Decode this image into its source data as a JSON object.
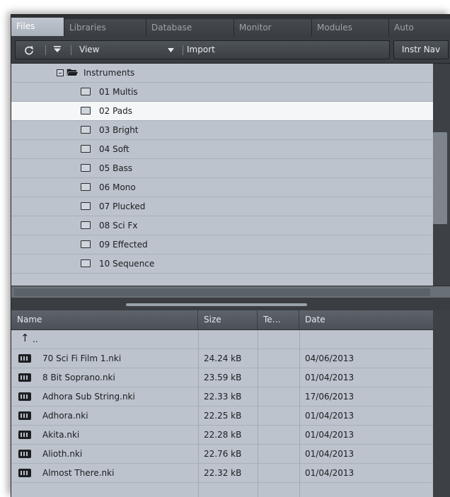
{
  "tabs": [
    {
      "label": "Files",
      "active": true
    },
    {
      "label": "Libraries",
      "active": false
    },
    {
      "label": "Database",
      "active": false
    },
    {
      "label": "Monitor",
      "active": false
    },
    {
      "label": "Modules",
      "active": false
    },
    {
      "label": "Auto",
      "active": false
    }
  ],
  "toolbar": {
    "refresh_icon": "refresh-icon",
    "menu_icon": "triangle-down-icon",
    "view_label": "View",
    "view_dropdown_icon": "triangle-down-icon",
    "import_label": "Import",
    "instr_nav_label": "Instr Nav"
  },
  "tree": {
    "parent": {
      "label": "Instruments",
      "expanded": true
    },
    "folders": [
      {
        "label": "01 Multis",
        "selected": false
      },
      {
        "label": "02 Pads",
        "selected": true
      },
      {
        "label": "03 Bright",
        "selected": false
      },
      {
        "label": "04 Soft",
        "selected": false
      },
      {
        "label": "05 Bass",
        "selected": false
      },
      {
        "label": "06 Mono",
        "selected": false
      },
      {
        "label": "07 Plucked",
        "selected": false
      },
      {
        "label": "08 Sci Fx",
        "selected": false
      },
      {
        "label": "09 Effected",
        "selected": false
      },
      {
        "label": "10 Sequence",
        "selected": false
      }
    ]
  },
  "table": {
    "columns": [
      "Name",
      "Size",
      "Te…",
      "Date"
    ],
    "parent_row": {
      "label": ".."
    },
    "rows": [
      {
        "name": "70 Sci Fi Film 1.nki",
        "size": "24.24 kB",
        "te": "",
        "date": "04/06/2013"
      },
      {
        "name": "8 Bit Soprano.nki",
        "size": "23.59 kB",
        "te": "",
        "date": "01/04/2013"
      },
      {
        "name": "Adhora Sub String.nki",
        "size": "22.33 kB",
        "te": "",
        "date": "17/06/2013"
      },
      {
        "name": "Adhora.nki",
        "size": "22.25 kB",
        "te": "",
        "date": "01/04/2013"
      },
      {
        "name": "Akita.nki",
        "size": "22.28 kB",
        "te": "",
        "date": "01/04/2013"
      },
      {
        "name": "Alioth.nki",
        "size": "22.76 kB",
        "te": "",
        "date": "01/04/2013"
      },
      {
        "name": "Almost There.nki",
        "size": "22.32 kB",
        "te": "",
        "date": "01/04/2013"
      }
    ]
  }
}
